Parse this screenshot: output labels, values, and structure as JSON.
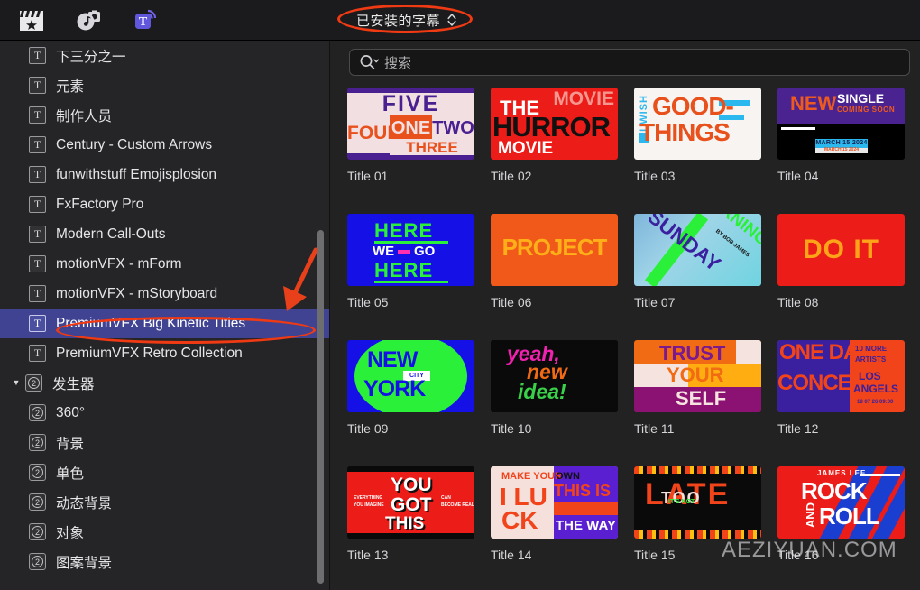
{
  "toolbar": {
    "icons": [
      {
        "name": "video-clapperboard-icon",
        "label": "影片"
      },
      {
        "name": "audio-photos-icon",
        "label": "音频与照片"
      },
      {
        "name": "titles-generators-icon",
        "label": "字幕和发生器"
      }
    ],
    "dropdown": {
      "value": "已安装的字幕",
      "accent": "#ef3a13"
    }
  },
  "search": {
    "placeholder": "搜索",
    "value": "",
    "icon": "search-icon"
  },
  "sidebar": {
    "items": [
      {
        "label": "下三分之一",
        "icon": "title-icon",
        "level": 1,
        "selected": false
      },
      {
        "label": "元素",
        "icon": "title-icon",
        "level": 1,
        "selected": false
      },
      {
        "label": "制作人员",
        "icon": "title-icon",
        "level": 1,
        "selected": false
      },
      {
        "label": "Century - Custom Arrows",
        "icon": "title-icon",
        "level": 1,
        "selected": false
      },
      {
        "label": "funwithstuff Emojisplosion",
        "icon": "title-icon",
        "level": 1,
        "selected": false
      },
      {
        "label": "FxFactory Pro",
        "icon": "title-icon",
        "level": 1,
        "selected": false
      },
      {
        "label": "Modern Call-Outs",
        "icon": "title-icon",
        "level": 1,
        "selected": false
      },
      {
        "label": "motionVFX - mForm",
        "icon": "title-icon",
        "level": 1,
        "selected": false
      },
      {
        "label": "motionVFX - mStoryboard",
        "icon": "title-icon",
        "level": 1,
        "selected": false
      },
      {
        "label": "PremiumVFX Big Kinetic Titles",
        "icon": "title-icon",
        "level": 1,
        "selected": true
      },
      {
        "label": "PremiumVFX Retro Collection",
        "icon": "title-icon",
        "level": 1,
        "selected": false
      },
      {
        "label": "发生器",
        "icon": "generator-icon",
        "level": 0,
        "selected": false,
        "expanded": true,
        "disclosure": "▼"
      },
      {
        "label": "360°",
        "icon": "generator-icon",
        "level": 1,
        "selected": false
      },
      {
        "label": "背景",
        "icon": "generator-icon",
        "level": 1,
        "selected": false
      },
      {
        "label": "单色",
        "icon": "generator-icon",
        "level": 1,
        "selected": false
      },
      {
        "label": "动态背景",
        "icon": "generator-icon",
        "level": 1,
        "selected": false
      },
      {
        "label": "对象",
        "icon": "generator-icon",
        "level": 1,
        "selected": false
      },
      {
        "label": "图案背景",
        "icon": "generator-icon",
        "level": 1,
        "selected": false
      }
    ]
  },
  "browser": {
    "items": [
      {
        "label": "Title 01",
        "art": "five-four-one-two-three"
      },
      {
        "label": "Title 02",
        "art": "the-horror-movie"
      },
      {
        "label": "Title 03",
        "art": "i-wish-good-things"
      },
      {
        "label": "Title 04",
        "art": "new-single-coming-soon"
      },
      {
        "label": "Title 05",
        "art": "here-we-go-here"
      },
      {
        "label": "Title 06",
        "art": "project"
      },
      {
        "label": "Title 07",
        "art": "sunday-morning"
      },
      {
        "label": "Title 08",
        "art": "do-it"
      },
      {
        "label": "Title 09",
        "art": "new-york-city"
      },
      {
        "label": "Title 10",
        "art": "yeah-new-idea"
      },
      {
        "label": "Title 11",
        "art": "trust-your-self"
      },
      {
        "label": "Title 12",
        "art": "one-day-concert"
      },
      {
        "label": "Title 13",
        "art": "you-got-this"
      },
      {
        "label": "Title 14",
        "art": "make-your-own-luck"
      },
      {
        "label": "Title 15",
        "art": "late"
      },
      {
        "label": "Title 16",
        "art": "rock-and-roll"
      }
    ],
    "art_text": {
      "five-four-one-two-three": [
        "FIVE",
        "FOUR",
        "ONE",
        "TWO",
        "THREE"
      ],
      "the-horror-movie": [
        "THE",
        "MOVIE",
        "HURROR",
        "MOVIE"
      ],
      "i-wish-good-things": [
        "I WISH",
        "GOOD-",
        "THINGS"
      ],
      "new-single-coming-soon": [
        "NEW",
        "SINGLE",
        "COMING SOON",
        "MARCH 15 2024"
      ],
      "here-we-go-here": [
        "HERE",
        "WE-GO",
        "HERE"
      ],
      "project": [
        "PROJECT"
      ],
      "sunday-morning": [
        "SUNDAY",
        "MORNING",
        "BY BOB JAMES"
      ],
      "do-it": [
        "DO IT"
      ],
      "new-york-city": [
        "NEW",
        "CITY",
        "YORK"
      ],
      "yeah-new-idea": [
        "yeah,",
        "new",
        "idea!"
      ],
      "trust-your-self": [
        "TRUST",
        "YOUR",
        "SELF"
      ],
      "one-day-concert": [
        "ONE DAY",
        "CONCERT",
        "10 MORE ARTISTS",
        "LOS ANGELS",
        "18 07 26 09:00"
      ],
      "you-got-this": [
        "YOU",
        "GOT",
        "THIS",
        "EVERYTHING YOU IMAGINE",
        "CAN BECOME REAL"
      ],
      "make-your-own-luck": [
        "MAKE YOUR OWN",
        "I LU",
        "CK",
        "THIS IS",
        "THE WAY"
      ],
      "late": [
        "LATE",
        "IT'S NOT",
        "TOO"
      ],
      "rock-and-roll": [
        "JAMES LEE",
        "ROCK",
        "AND",
        "ROLL"
      ]
    }
  },
  "watermark": {
    "text": "AEZIYUAN.COM"
  },
  "annotations": {
    "ellipse_dropdown": true,
    "ellipse_sidebar_selected": true,
    "arrow_to_selected": true,
    "color": "#ef3a13"
  }
}
